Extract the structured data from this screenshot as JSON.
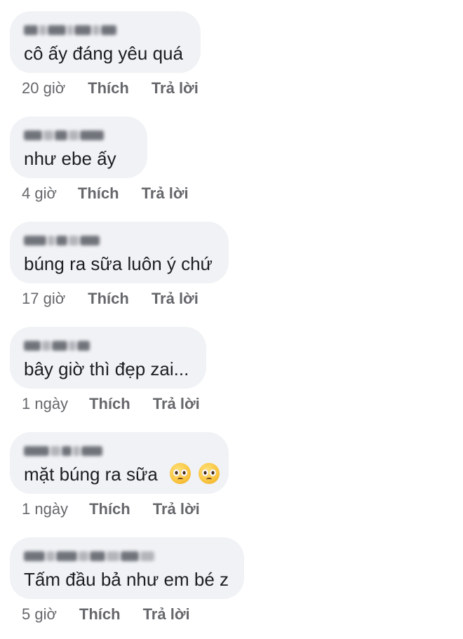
{
  "comments": [
    {
      "text": "cô ấy đáng yêu quá",
      "time": "20 giờ",
      "like": "Thích",
      "reply": "Trả lời",
      "emojis": []
    },
    {
      "text": "như ebe ấy",
      "time": "4 giờ",
      "like": "Thích",
      "reply": "Trả lời",
      "emojis": []
    },
    {
      "text": "búng ra sữa luôn ý chứ",
      "time": "17 giờ",
      "like": "Thích",
      "reply": "Trả lời",
      "emojis": []
    },
    {
      "text": "bây giờ thì đẹp zai...",
      "time": "1 ngày",
      "like": "Thích",
      "reply": "Trả lời",
      "emojis": []
    },
    {
      "text": "mặt búng ra sữa",
      "time": "1 ngày",
      "like": "Thích",
      "reply": "Trả lời",
      "emojis": [
        "pleading-face",
        "pleading-face"
      ]
    },
    {
      "text": "Tấm đầu bả như em bé z",
      "time": "5 giờ",
      "like": "Thích",
      "reply": "Trả lời",
      "emojis": []
    }
  ],
  "colors": {
    "bubble": "#f0f2f5",
    "text": "#1c1e21",
    "meta": "#65676b"
  }
}
